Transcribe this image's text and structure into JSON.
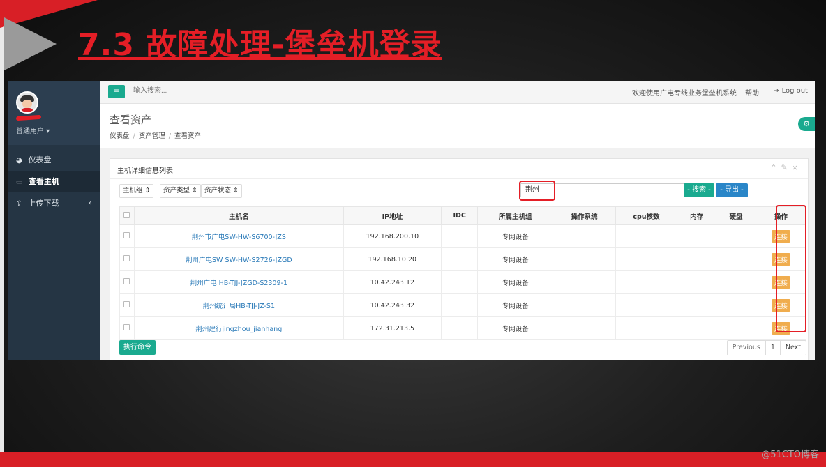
{
  "slide": {
    "title": "7.3 故障处理-堡垒机登录",
    "watermark": "@51CTO博客",
    "accent_color": "#d81f26"
  },
  "app": {
    "sidebar": {
      "user_role": "普通用户 ▾",
      "items": [
        {
          "icon": "dashboard-icon",
          "label": "仪表盘"
        },
        {
          "icon": "monitor-icon",
          "label": "查看主机"
        },
        {
          "icon": "upload-icon",
          "label": "上传下载"
        }
      ]
    },
    "topbar": {
      "search_placeholder": "输入搜索...",
      "welcome": "欢迎使用广电专线业务堡垒机系统",
      "help": "帮助",
      "logout": "Log out"
    },
    "header": {
      "title": "查看资产",
      "breadcrumb": [
        "仪表盘",
        "资产管理",
        "查看资产"
      ]
    },
    "box": {
      "title": "主机详细信息列表",
      "filters": [
        "主机组 ⇕",
        "资产类型 ⇕",
        "资产状态 ⇕"
      ],
      "keyword": "荆州",
      "search_label": "- 搜索 -",
      "export_label": "- 导出 -",
      "columns": [
        "主机名",
        "IP地址",
        "IDC",
        "所属主机组",
        "操作系统",
        "cpu核数",
        "内存",
        "硬盘",
        "操作"
      ],
      "rows": [
        {
          "name": "荆州市广电SW-HW-S6700-JZS",
          "ip": "192.168.200.10",
          "idc": "",
          "group": "专网设备",
          "os": "",
          "cpu": "",
          "mem": "",
          "disk": "",
          "action": "连接"
        },
        {
          "name": "荆州广电SW SW-HW-S2726-JZGD",
          "ip": "192.168.10.20",
          "idc": "",
          "group": "专网设备",
          "os": "",
          "cpu": "",
          "mem": "",
          "disk": "",
          "action": "连接"
        },
        {
          "name": "荆州广电 HB-TJJ-JZGD-S2309-1",
          "ip": "10.42.243.12",
          "idc": "",
          "group": "专网设备",
          "os": "",
          "cpu": "",
          "mem": "",
          "disk": "",
          "action": "连接"
        },
        {
          "name": "荆州统计局HB-TJJ-JZ-S1",
          "ip": "10.42.243.32",
          "idc": "",
          "group": "专网设备",
          "os": "",
          "cpu": "",
          "mem": "",
          "disk": "",
          "action": "连接"
        },
        {
          "name": "荆州建行jingzhou_jianhang",
          "ip": "172.31.213.5",
          "idc": "",
          "group": "专网设备",
          "os": "",
          "cpu": "",
          "mem": "",
          "disk": "",
          "action": "连接"
        }
      ],
      "exec_label": "执行命令",
      "pager": [
        "Previous",
        "1",
        "Next"
      ]
    },
    "colors": {
      "primary": "#1aaa8f",
      "export": "#2a86c8",
      "connect": "#f0ad4e",
      "sidebar": "#253544"
    }
  }
}
